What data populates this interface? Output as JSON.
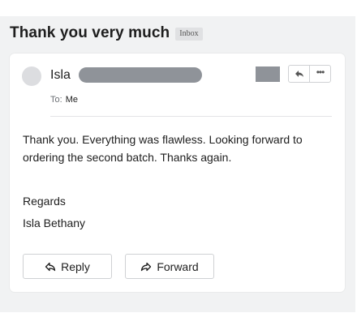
{
  "message": {
    "subject": "Thank you very much",
    "folder_badge": "Inbox",
    "sender_name": "Isla",
    "to_label": "To:",
    "to_value": "Me",
    "body": "Thank you. Everything was flawless. Looking forward to ordering the second batch. Thanks again.",
    "closing_line_1": "Regards",
    "closing_line_2": "Isla Bethany"
  },
  "header_actions": {
    "reply_icon": "reply-arrow-icon",
    "more_icon": "more-dots-icon",
    "more_glyph": "•••"
  },
  "footer_actions": {
    "reply_label": "Reply",
    "forward_label": "Forward",
    "reply_icon": "reply-arrow-icon",
    "forward_icon": "forward-arrow-icon"
  },
  "colors": {
    "pane_background": "#f1f2f3",
    "card_background": "#ffffff",
    "redaction": "#8f9399",
    "text": "#1e1e1e"
  }
}
